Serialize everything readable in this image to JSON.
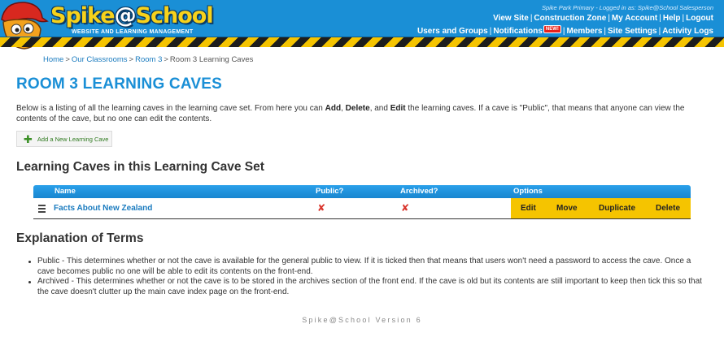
{
  "header": {
    "brand_main": "Spike",
    "brand_at": "@",
    "brand_school": "School",
    "tagline": "WEBSITE AND LEARNING MANAGEMENT",
    "login_info": "Spike Park Primary - Logged in as: Spike@School Salesperson",
    "nav_row1": [
      {
        "label": "View Site"
      },
      {
        "label": "Construction Zone"
      },
      {
        "label": "My Account"
      },
      {
        "label": "Help"
      },
      {
        "label": "Logout"
      }
    ],
    "nav_row2": [
      {
        "label": "Users and Groups"
      },
      {
        "label": "Notifications",
        "badge": "NEW!"
      },
      {
        "label": "Members"
      },
      {
        "label": "Site Settings"
      },
      {
        "label": "Activity Logs"
      }
    ],
    "colors": {
      "bar": "#1a8fd6",
      "hazard_yellow": "#f5c400",
      "hazard_black": "#1d1d1d"
    }
  },
  "breadcrumb": [
    {
      "label": "Home"
    },
    {
      "label": "Our Classrooms"
    },
    {
      "label": "Room 3"
    },
    {
      "label": "Room 3 Learning Caves"
    }
  ],
  "page_title": "ROOM 3 LEARNING CAVES",
  "intro": {
    "part1": "Below is a listing of all the learning caves in the learning cave set. From here you can ",
    "add": "Add",
    "comma1": ", ",
    "delete": "Delete",
    "and": ", and ",
    "edit": "Edit",
    "part2": " the learning caves. If a cave is \"Public\", that means that anyone can view the contents of the cave, but no one can edit the contents."
  },
  "add_button": {
    "icon": "plus-icon",
    "label": "Add a New Learning Cave"
  },
  "table_section_title": "Learning Caves in this Learning Cave Set",
  "table": {
    "headers": {
      "name": "Name",
      "public": "Public?",
      "archived": "Archived?",
      "options": "Options"
    },
    "rows": [
      {
        "name": "Facts About New Zealand",
        "public_icon": "x-icon",
        "archived_icon": "x-icon",
        "options": [
          "Edit",
          "Move",
          "Duplicate",
          "Delete"
        ]
      }
    ],
    "colors": {
      "header": "#1a8fd6",
      "options_bg": "#f5c400",
      "untick": "#d9342b"
    }
  },
  "explanation_title": "Explanation of Terms",
  "terms": [
    "Public - This determines whether or not the cave is available for the general public to view. If it is ticked then that means that users won't need a password to access the cave. Once a cave becomes public no one will be able to edit its contents on the front-end.",
    "Archived - This determines whether or not the cave is to be stored in the archives section of the front end. If the cave is old but its contents are still important to keep then tick this so that the cave doesn't clutter up the main cave index page on the front-end."
  ],
  "footer": "Spike@School Version 6"
}
